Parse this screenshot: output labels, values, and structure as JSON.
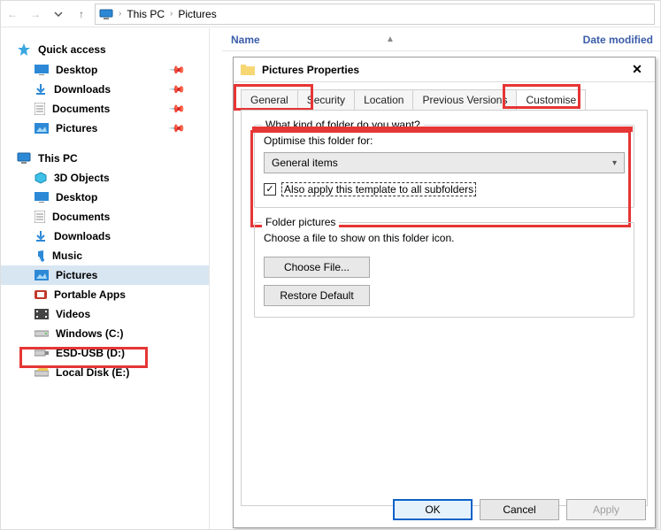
{
  "breadcrumb": {
    "root_label": "This PC",
    "current_label": "Pictures"
  },
  "columns": {
    "name": "Name",
    "date_modified": "Date modified"
  },
  "tree": {
    "quick_access": {
      "label": "Quick access",
      "items": [
        {
          "label": "Desktop"
        },
        {
          "label": "Downloads"
        },
        {
          "label": "Documents"
        },
        {
          "label": "Pictures"
        }
      ]
    },
    "this_pc": {
      "label": "This PC",
      "items": [
        {
          "label": "3D Objects"
        },
        {
          "label": "Desktop"
        },
        {
          "label": "Documents"
        },
        {
          "label": "Downloads"
        },
        {
          "label": "Music"
        },
        {
          "label": "Pictures"
        },
        {
          "label": "Portable Apps"
        },
        {
          "label": "Videos"
        },
        {
          "label": "Windows (C:)"
        },
        {
          "label": "ESD-USB (D:)"
        },
        {
          "label": "Local Disk (E:)"
        }
      ]
    }
  },
  "dialog": {
    "title": "Pictures Properties",
    "tabs": {
      "general": "General",
      "security": "Security",
      "location": "Location",
      "previous_versions": "Previous Versions",
      "customise": "Customise"
    },
    "section1": {
      "heading": "What kind of folder do you want?",
      "optimise_label": "Optimise this folder for:",
      "combo_value": "General items",
      "subfolders_label": "Also apply this template to all subfolders"
    },
    "section2": {
      "heading": "Folder pictures",
      "desc": "Choose a file to show on this folder icon.",
      "choose_file": "Choose File...",
      "restore_default": "Restore Default"
    },
    "buttons": {
      "ok": "OK",
      "cancel": "Cancel",
      "apply": "Apply"
    }
  }
}
